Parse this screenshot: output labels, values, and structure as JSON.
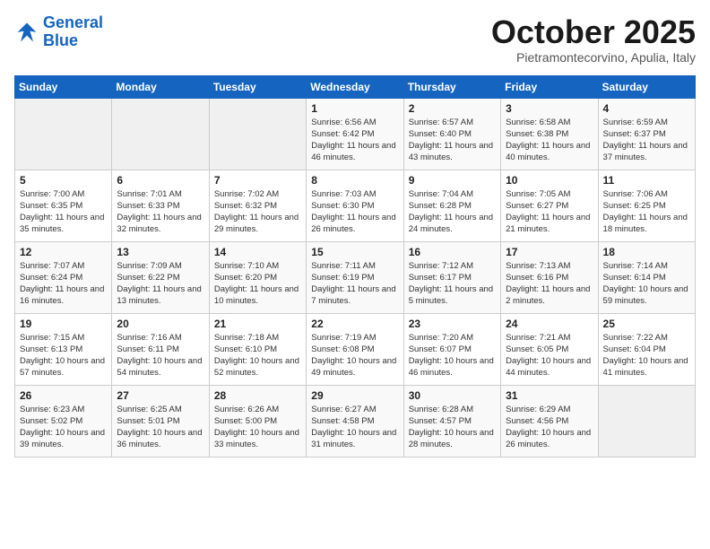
{
  "logo": {
    "line1": "General",
    "line2": "Blue"
  },
  "title": "October 2025",
  "subtitle": "Pietramontecorvino, Apulia, Italy",
  "days_of_week": [
    "Sunday",
    "Monday",
    "Tuesday",
    "Wednesday",
    "Thursday",
    "Friday",
    "Saturday"
  ],
  "weeks": [
    [
      {
        "day": "",
        "info": ""
      },
      {
        "day": "",
        "info": ""
      },
      {
        "day": "",
        "info": ""
      },
      {
        "day": "1",
        "info": "Sunrise: 6:56 AM\nSunset: 6:42 PM\nDaylight: 11 hours and 46 minutes."
      },
      {
        "day": "2",
        "info": "Sunrise: 6:57 AM\nSunset: 6:40 PM\nDaylight: 11 hours and 43 minutes."
      },
      {
        "day": "3",
        "info": "Sunrise: 6:58 AM\nSunset: 6:38 PM\nDaylight: 11 hours and 40 minutes."
      },
      {
        "day": "4",
        "info": "Sunrise: 6:59 AM\nSunset: 6:37 PM\nDaylight: 11 hours and 37 minutes."
      }
    ],
    [
      {
        "day": "5",
        "info": "Sunrise: 7:00 AM\nSunset: 6:35 PM\nDaylight: 11 hours and 35 minutes."
      },
      {
        "day": "6",
        "info": "Sunrise: 7:01 AM\nSunset: 6:33 PM\nDaylight: 11 hours and 32 minutes."
      },
      {
        "day": "7",
        "info": "Sunrise: 7:02 AM\nSunset: 6:32 PM\nDaylight: 11 hours and 29 minutes."
      },
      {
        "day": "8",
        "info": "Sunrise: 7:03 AM\nSunset: 6:30 PM\nDaylight: 11 hours and 26 minutes."
      },
      {
        "day": "9",
        "info": "Sunrise: 7:04 AM\nSunset: 6:28 PM\nDaylight: 11 hours and 24 minutes."
      },
      {
        "day": "10",
        "info": "Sunrise: 7:05 AM\nSunset: 6:27 PM\nDaylight: 11 hours and 21 minutes."
      },
      {
        "day": "11",
        "info": "Sunrise: 7:06 AM\nSunset: 6:25 PM\nDaylight: 11 hours and 18 minutes."
      }
    ],
    [
      {
        "day": "12",
        "info": "Sunrise: 7:07 AM\nSunset: 6:24 PM\nDaylight: 11 hours and 16 minutes."
      },
      {
        "day": "13",
        "info": "Sunrise: 7:09 AM\nSunset: 6:22 PM\nDaylight: 11 hours and 13 minutes."
      },
      {
        "day": "14",
        "info": "Sunrise: 7:10 AM\nSunset: 6:20 PM\nDaylight: 11 hours and 10 minutes."
      },
      {
        "day": "15",
        "info": "Sunrise: 7:11 AM\nSunset: 6:19 PM\nDaylight: 11 hours and 7 minutes."
      },
      {
        "day": "16",
        "info": "Sunrise: 7:12 AM\nSunset: 6:17 PM\nDaylight: 11 hours and 5 minutes."
      },
      {
        "day": "17",
        "info": "Sunrise: 7:13 AM\nSunset: 6:16 PM\nDaylight: 11 hours and 2 minutes."
      },
      {
        "day": "18",
        "info": "Sunrise: 7:14 AM\nSunset: 6:14 PM\nDaylight: 10 hours and 59 minutes."
      }
    ],
    [
      {
        "day": "19",
        "info": "Sunrise: 7:15 AM\nSunset: 6:13 PM\nDaylight: 10 hours and 57 minutes."
      },
      {
        "day": "20",
        "info": "Sunrise: 7:16 AM\nSunset: 6:11 PM\nDaylight: 10 hours and 54 minutes."
      },
      {
        "day": "21",
        "info": "Sunrise: 7:18 AM\nSunset: 6:10 PM\nDaylight: 10 hours and 52 minutes."
      },
      {
        "day": "22",
        "info": "Sunrise: 7:19 AM\nSunset: 6:08 PM\nDaylight: 10 hours and 49 minutes."
      },
      {
        "day": "23",
        "info": "Sunrise: 7:20 AM\nSunset: 6:07 PM\nDaylight: 10 hours and 46 minutes."
      },
      {
        "day": "24",
        "info": "Sunrise: 7:21 AM\nSunset: 6:05 PM\nDaylight: 10 hours and 44 minutes."
      },
      {
        "day": "25",
        "info": "Sunrise: 7:22 AM\nSunset: 6:04 PM\nDaylight: 10 hours and 41 minutes."
      }
    ],
    [
      {
        "day": "26",
        "info": "Sunrise: 6:23 AM\nSunset: 5:02 PM\nDaylight: 10 hours and 39 minutes."
      },
      {
        "day": "27",
        "info": "Sunrise: 6:25 AM\nSunset: 5:01 PM\nDaylight: 10 hours and 36 minutes."
      },
      {
        "day": "28",
        "info": "Sunrise: 6:26 AM\nSunset: 5:00 PM\nDaylight: 10 hours and 33 minutes."
      },
      {
        "day": "29",
        "info": "Sunrise: 6:27 AM\nSunset: 4:58 PM\nDaylight: 10 hours and 31 minutes."
      },
      {
        "day": "30",
        "info": "Sunrise: 6:28 AM\nSunset: 4:57 PM\nDaylight: 10 hours and 28 minutes."
      },
      {
        "day": "31",
        "info": "Sunrise: 6:29 AM\nSunset: 4:56 PM\nDaylight: 10 hours and 26 minutes."
      },
      {
        "day": "",
        "info": ""
      }
    ]
  ]
}
